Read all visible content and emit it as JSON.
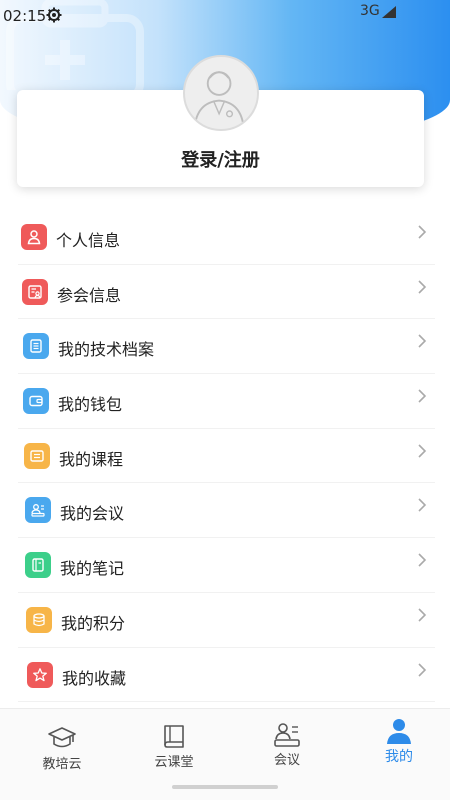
{
  "status_bar": {
    "time": "02:15",
    "network": "3G",
    "settings_icon": "gear-icon",
    "signal_icon": "signal-icon"
  },
  "profile": {
    "avatar_icon": "doctor-avatar-icon",
    "login_label": "登录/注册"
  },
  "menu": {
    "items": [
      {
        "label": "个人信息",
        "icon": "person-icon",
        "color": "#ef5a5a"
      },
      {
        "label": "参会信息",
        "icon": "attendee-card-icon",
        "color": "#ef5a5a"
      },
      {
        "label": "我的技术档案",
        "icon": "file-icon",
        "color": "#4aa8ee"
      },
      {
        "label": "我的钱包",
        "icon": "wallet-icon",
        "color": "#4aa8ee"
      },
      {
        "label": "我的课程",
        "icon": "course-icon",
        "color": "#f7b548"
      },
      {
        "label": "我的会议",
        "icon": "meeting-icon",
        "color": "#4aa8ee"
      },
      {
        "label": "我的笔记",
        "icon": "notes-icon",
        "color": "#3ccf8a"
      },
      {
        "label": "我的积分",
        "icon": "coins-icon",
        "color": "#f7b548"
      },
      {
        "label": "我的收藏",
        "icon": "star-icon",
        "color": "#ef5a5a"
      }
    ],
    "chevron_icon": "chevron-right-icon"
  },
  "tabs": [
    {
      "label": "教培云",
      "icon": "graduation-cap-icon",
      "active": false
    },
    {
      "label": "云课堂",
      "icon": "book-icon",
      "active": false
    },
    {
      "label": "会议",
      "icon": "meeting-icon",
      "active": false
    },
    {
      "label": "我的",
      "icon": "user-icon",
      "active": true
    }
  ],
  "colors": {
    "accent": "#2d8be9",
    "header_gradient_start": "#f2f8fe",
    "header_gradient_end": "#2c8ff0"
  }
}
